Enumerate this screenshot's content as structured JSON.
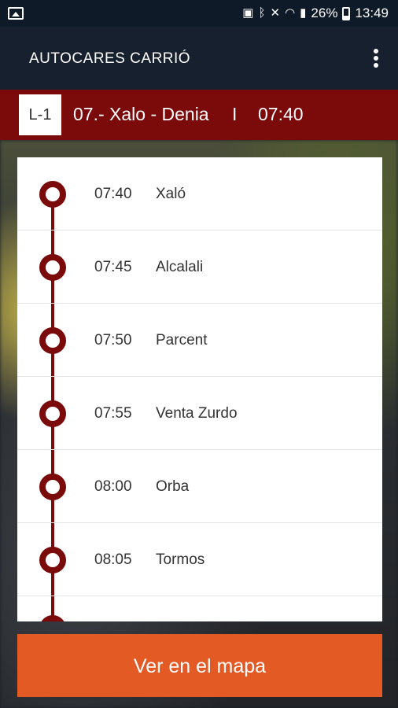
{
  "status": {
    "battery": "26%",
    "time": "13:49"
  },
  "appbar": {
    "title": "AUTOCARES CARRIÓ"
  },
  "route": {
    "code": "L-1",
    "name": "07.- Xalo - Denia",
    "separator": "I",
    "time": "07:40"
  },
  "stops": [
    {
      "time": "07:40",
      "name": "Xaló"
    },
    {
      "time": "07:45",
      "name": "Alcalali"
    },
    {
      "time": "07:50",
      "name": "Parcent"
    },
    {
      "time": "07:55",
      "name": "Venta Zurdo"
    },
    {
      "time": "08:00",
      "name": "Orba"
    },
    {
      "time": "08:05",
      "name": "Tormos"
    }
  ],
  "map_button": {
    "label": "Ver en el mapa"
  },
  "colors": {
    "accent": "#7b0a0a",
    "button": "#e35a25",
    "appbar": "#16202e"
  }
}
